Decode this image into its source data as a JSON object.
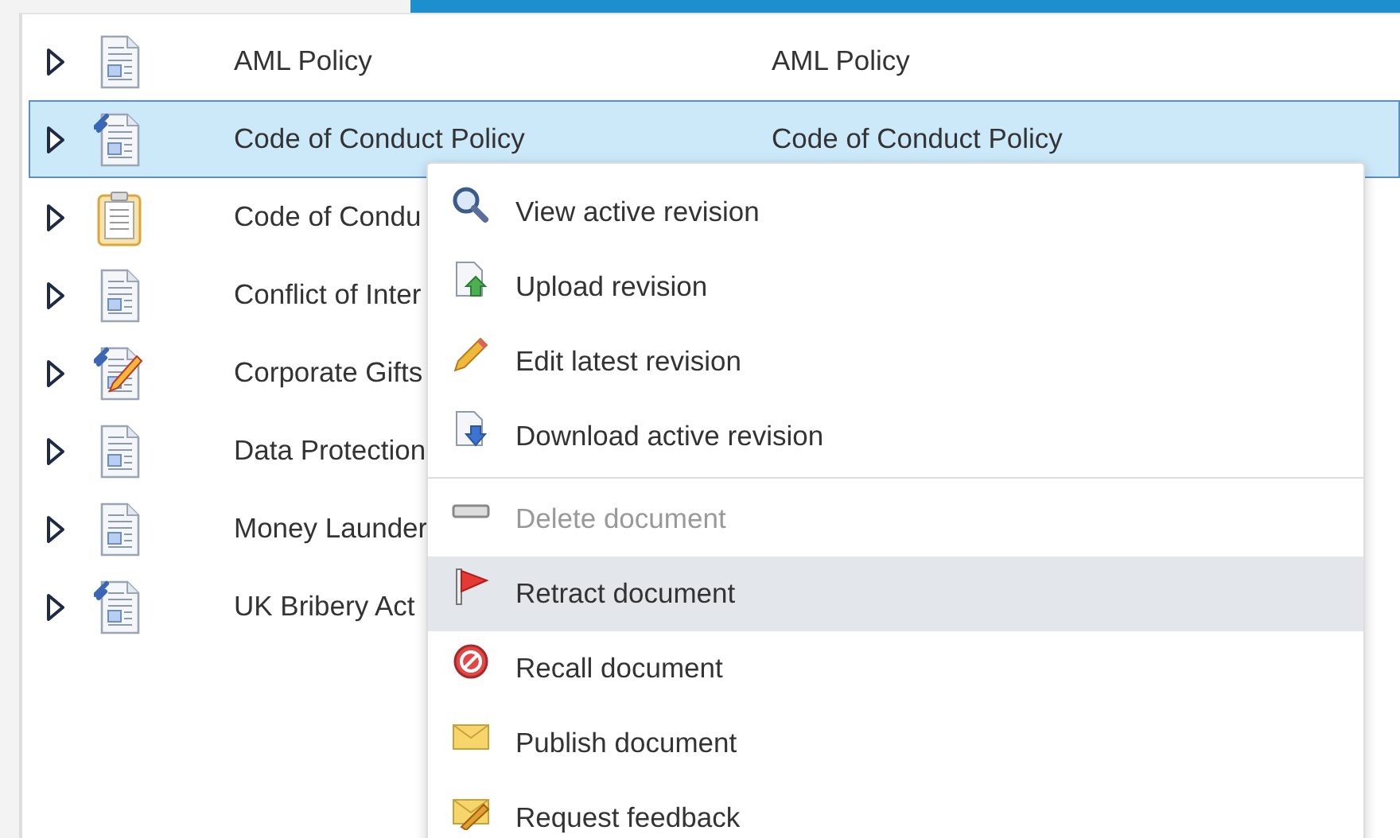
{
  "rows": [
    {
      "kind": "document",
      "name": "AML Policy",
      "column_2": "AML Policy",
      "selected": false
    },
    {
      "kind": "linked",
      "name": "Code of Conduct Policy",
      "column_2": "Code of Conduct Policy",
      "selected": true
    },
    {
      "kind": "clipboard",
      "name": "Code of Condu",
      "selected": false
    },
    {
      "kind": "document",
      "name": "Conflict of Inter",
      "selected": false
    },
    {
      "kind": "edit",
      "name": "Corporate Gifts",
      "selected": false
    },
    {
      "kind": "document",
      "name": "Data Protection",
      "selected": false
    },
    {
      "kind": "document",
      "name": "Money Launder",
      "selected": false
    },
    {
      "kind": "linked",
      "name": "UK Bribery Act",
      "selected": false
    }
  ],
  "context_menu": {
    "items": [
      {
        "kind": "view",
        "label": "View active revision",
        "disabled": false,
        "selected": false
      },
      {
        "kind": "upload",
        "label": "Upload revision",
        "disabled": false,
        "selected": false
      },
      {
        "kind": "edit",
        "label": "Edit latest revision",
        "disabled": false,
        "selected": false
      },
      {
        "kind": "download",
        "label": "Download active revision",
        "disabled": false,
        "selected": false,
        "separator_after": true
      },
      {
        "kind": "delete",
        "label": "Delete document",
        "disabled": true,
        "selected": false
      },
      {
        "kind": "retract",
        "label": "Retract document",
        "disabled": false,
        "selected": true
      },
      {
        "kind": "recall",
        "label": "Recall document",
        "disabled": false,
        "selected": false
      },
      {
        "kind": "publish",
        "label": "Publish document",
        "disabled": false,
        "selected": false
      },
      {
        "kind": "feedback",
        "label": "Request feedback",
        "disabled": false,
        "selected": false
      }
    ]
  }
}
